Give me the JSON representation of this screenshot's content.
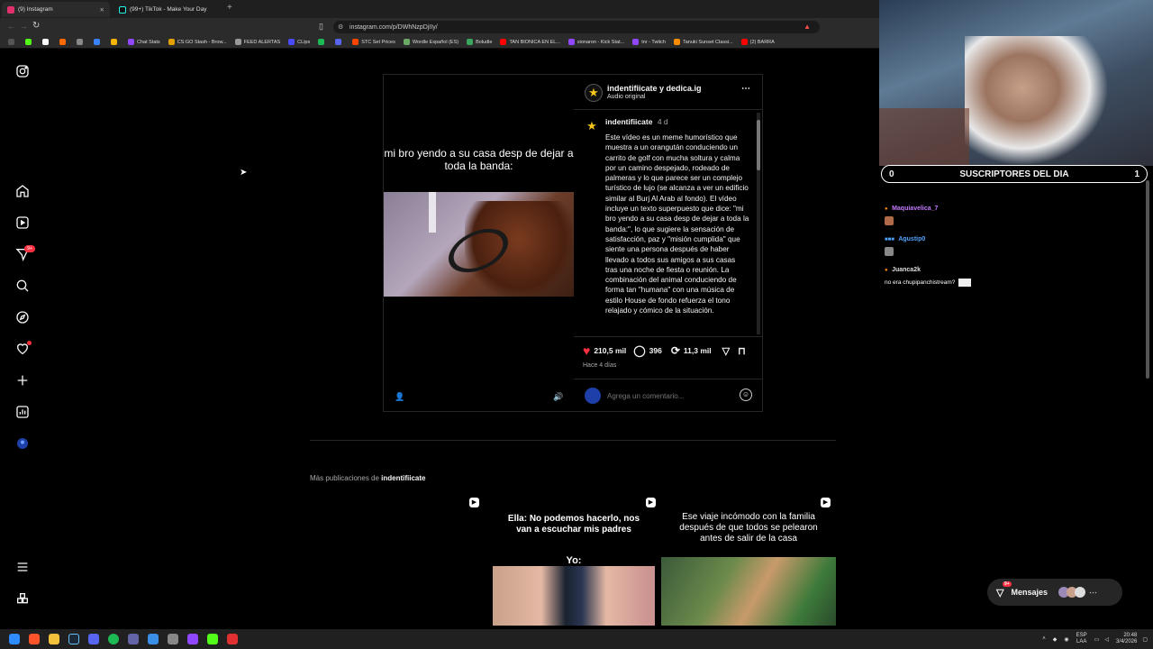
{
  "browser": {
    "tabs": [
      {
        "title": "(9) Instagram",
        "active": true
      },
      {
        "title": "(99+) TikTok - Make Your Day",
        "active": false
      }
    ],
    "url": "instagram.com/p/DWhNzpDjIIy/",
    "bookmarks": [
      "Chat Stats",
      "CS:GO Stash - Brow...",
      "FEED ALERTAS",
      "CLips",
      "STC Set Prices",
      "Wordle Español (ES)",
      "Boludle",
      "TAN BIONICA EN EL...",
      "sionaron - Kick Stat...",
      "tnr - Twitch",
      "Tanuki Sunset Classi...",
      "(2) BARRA"
    ]
  },
  "sidebar": {
    "notifications_badge": "9+",
    "icons": [
      "instagram-logo-icon",
      "home-icon",
      "reels-icon",
      "messages-icon",
      "search-icon",
      "explore-icon",
      "notifications-icon",
      "create-icon",
      "dashboard-icon",
      "profile-icon",
      "menu-icon",
      "threads-icon"
    ]
  },
  "post": {
    "video_caption": "mi bro yendo a su casa desp de dejar a toda la banda:",
    "header_user": "indentifiicate y dedica.ig",
    "header_audio": "Audio original",
    "caption_user": "indentifiicate",
    "caption_time": "4 d",
    "caption_text": "Este vídeo es un meme humorístico que muestra a un orangután conduciendo un carrito de golf con mucha soltura y calma por un camino despejado, rodeado de palmeras y lo que parece ser un complejo turístico de lujo (se alcanza a ver un edificio similar al Burj Al Arab al fondo). El vídeo incluye un texto superpuesto que dice: \"mi bro yendo a su casa desp de dejar a toda la banda:\", lo que sugiere la sensación de satisfacción, paz y \"misión cumplida\" que siente una persona después de haber llevado a todos sus amigos a sus casas tras una noche de fiesta o reunión. La combinación del animal conduciendo de forma tan \"humana\" con una música de estilo House de fondo refuerza el tono relajado y cómico de la situación.",
    "likes": "210,5 mil",
    "comments": "396",
    "reposts": "11,3 mil",
    "posted": "Hace 4 días",
    "comment_placeholder": "Agrega un comentario..."
  },
  "more": {
    "label_prefix": "Más publicaciones de ",
    "label_user": "indentifiicate",
    "thumbs": [
      {
        "text": ""
      },
      {
        "text": "Ella: No podemos hacerlo, nos van a escuchar mis padres",
        "sub": "Yo:"
      },
      {
        "text": "Ese viaje incómodo con la familia después de que todos se pelearon antes de salir de la casa"
      }
    ]
  },
  "overlay": {
    "subs_left": "0",
    "subs_title": "SUSCRIPTORES DEL DIA",
    "subs_right": "1",
    "chat": [
      {
        "name": "Maquiavelica_7",
        "color": "#c47bff",
        "msg": ""
      },
      {
        "name": "Agustip0",
        "color": "#4fa3ff",
        "msg": ""
      },
      {
        "name": "Juanca2k",
        "color": "#dddddd",
        "msg": "no era chupipanchistream?"
      }
    ],
    "messages_label": "Mensajes",
    "messages_badge": "9+"
  },
  "taskbar": {
    "lang": "ESP",
    "lang_sub": "LAA",
    "time": "20:48",
    "date": "3/4/2026"
  }
}
